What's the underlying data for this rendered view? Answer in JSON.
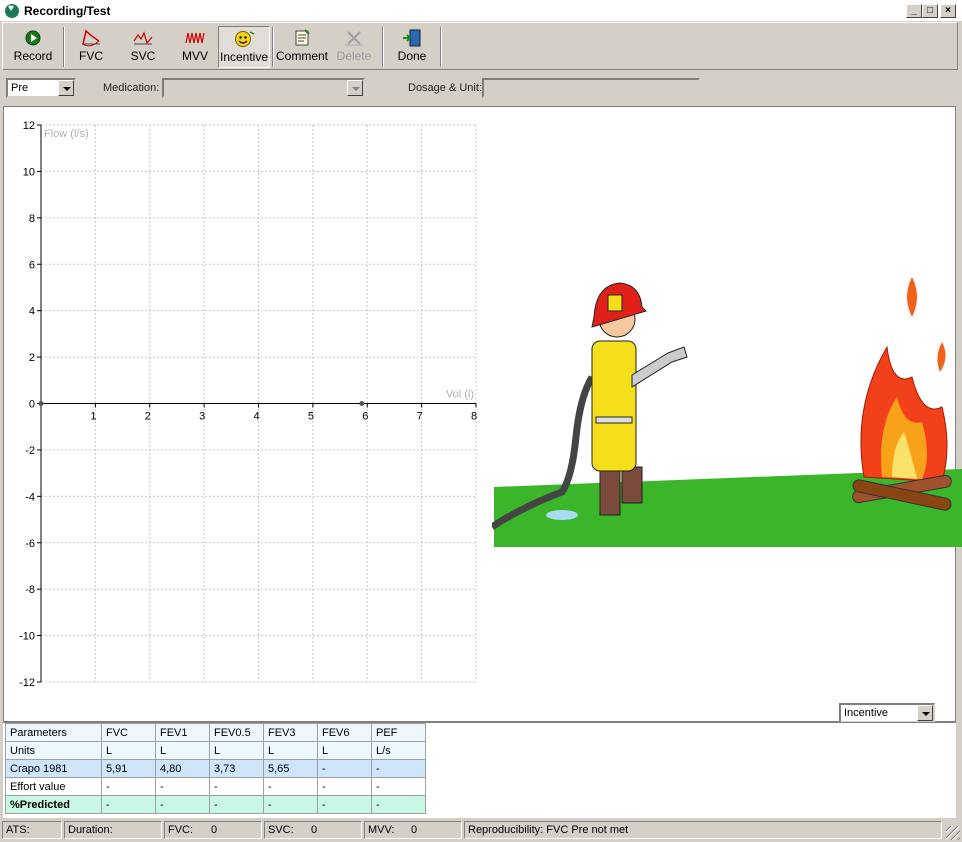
{
  "window": {
    "title": "Recording/Test"
  },
  "toolbar": {
    "record": "Record",
    "fvc": "FVC",
    "svc": "SVC",
    "mvv": "MVV",
    "incentive": "Incentive",
    "comment": "Comment",
    "delete": "Delete",
    "done": "Done"
  },
  "filter": {
    "phase_value": "Pre",
    "medication_label": "Medication:",
    "medication_value": "",
    "dosage_label": "Dosage & Unit:",
    "dosage_value": ""
  },
  "chart_data": {
    "type": "line",
    "ylabel": "Flow (l/s)",
    "xlabel": "Vol (l)",
    "xlim": [
      0,
      8
    ],
    "ylim": [
      -12,
      12
    ],
    "xticks": [
      1,
      2,
      3,
      4,
      5,
      6,
      7,
      8
    ],
    "yticks": [
      12,
      10,
      8,
      6,
      4,
      2,
      0,
      -2,
      -4,
      -6,
      -8,
      -10,
      -12
    ],
    "grid": true,
    "series": [
      {
        "x": [
          0,
          5.9
        ],
        "y": [
          0,
          0
        ]
      }
    ]
  },
  "incentive_select": {
    "value": "Incentive"
  },
  "params_table": {
    "headers": [
      "Parameters",
      "FVC",
      "FEV1",
      "FEV0.5",
      "FEV3",
      "FEV6",
      "PEF"
    ],
    "rows": [
      [
        "Units",
        "L",
        "L",
        "L",
        "L",
        "L",
        "L/s"
      ],
      [
        "Crapo 1981",
        "5,91",
        "4,80",
        "3,73",
        "5,65",
        "-",
        "-"
      ],
      [
        "Effort value",
        "-",
        "-",
        "-",
        "-",
        "-",
        "-"
      ],
      [
        "%Predicted",
        "-",
        "-",
        "-",
        "-",
        "-",
        "-"
      ]
    ]
  },
  "status": {
    "ats_label": "ATS:",
    "duration_label": "Duration:",
    "fvc_label": "FVC:",
    "fvc_value": "0",
    "svc_label": "SVC:",
    "svc_value": "0",
    "mvv_label": "MVV:",
    "mvv_value": "0",
    "reproducibility": "Reproducibility: FVC Pre not met"
  }
}
